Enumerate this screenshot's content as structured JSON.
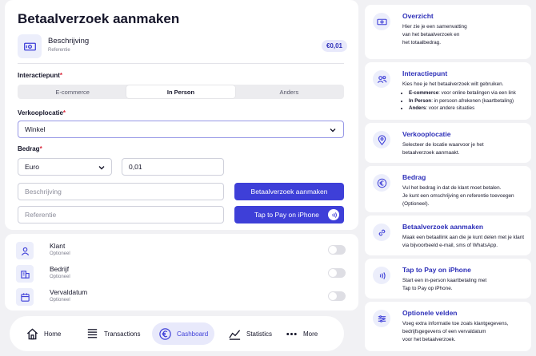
{
  "page": {
    "title": "Betaalverzoek aanmaken",
    "summary": {
      "label": "Beschrijving",
      "sublabel": "Referentie",
      "amount": "€0,01"
    },
    "interaction": {
      "label": "Interactiepunt",
      "required_mark": "*",
      "options": [
        "E-commerce",
        "In Person",
        "Anders"
      ],
      "selected": "In Person"
    },
    "location": {
      "label": "Verkooplocatie",
      "required_mark": "*",
      "value": "Winkel"
    },
    "amount": {
      "label": "Bedrag",
      "required_mark": "*",
      "currency": "Euro",
      "value": "0,01"
    },
    "description": {
      "placeholder": "Beschrijving"
    },
    "reference": {
      "placeholder": "Referentie"
    },
    "buttons": {
      "create": "Betaalverzoek aanmaken",
      "tap": "Tap to Pay on iPhone"
    },
    "optional": [
      {
        "label": "Klant",
        "sub": "Optioneel",
        "icon": "user-icon"
      },
      {
        "label": "Bedrijf",
        "sub": "Optioneel",
        "icon": "building-icon"
      },
      {
        "label": "Vervaldatum",
        "sub": "Optioneel",
        "icon": "calendar-icon"
      }
    ]
  },
  "nav": {
    "items": [
      {
        "label": "Home",
        "icon": "home-icon"
      },
      {
        "label": "Transactions",
        "icon": "list-icon"
      },
      {
        "label": "Cashboard",
        "icon": "euro-icon",
        "active": true
      },
      {
        "label": "Statistics",
        "icon": "chart-icon"
      },
      {
        "label": "More",
        "icon": "dots-icon"
      }
    ]
  },
  "sidebar": {
    "cards": [
      {
        "title": "Overzicht",
        "body": "Hier zie je een samenvatting\nvan het betaalverzoek en\nhet totaalbedrag.",
        "icon": "cash-icon"
      },
      {
        "title": "Interactiepunt",
        "body": "Kies hoe je het betaalverzoek wilt gebruiken.",
        "bullets": [
          {
            "bold": "E-commerce",
            "text": ": voor online betalingen via een link"
          },
          {
            "bold": "In Person",
            "text": ": in persoon afrekenen (kaartbetaling)"
          },
          {
            "bold": "Anders",
            "text": ": voor andere situaties"
          }
        ],
        "icon": "users-icon"
      },
      {
        "title": "Verkooplocatie",
        "body": "Selecteer de locatie waarvoor je het\nbetaalverzoek aanmaakt.",
        "icon": "pin-icon"
      },
      {
        "title": "Bedrag",
        "body": "Vul het bedrag in dat de klant moet betalen.\nJe kunt een omschrijving en referentie toevoegen\n(Optioneel).",
        "icon": "euro-icon"
      },
      {
        "title": "Betaalverzoek aanmaken",
        "body": "Maak een betaallink aan die je kunt delen met je klant\nvia bijvoorbeeld e-mail, sms of WhatsApp.",
        "icon": "link-icon"
      },
      {
        "title": "Tap to Pay on iPhone",
        "body": "Start een in-person kaartbetaling met\nTap to Pay op iPhone.",
        "icon": "contactless-icon"
      },
      {
        "title": "Optionele velden",
        "body": "Voeg extra informatie toe zoals klantgegevens,\nbedrijfsgegevens of een vervaldatum\nvoor het betaalverzoek.",
        "icon": "sliders-icon"
      }
    ]
  },
  "colors": {
    "accent": "#3e3fd8",
    "title_blue": "#2d2fb8",
    "tile_bg": "#eceefb",
    "required": "#d9263a"
  }
}
